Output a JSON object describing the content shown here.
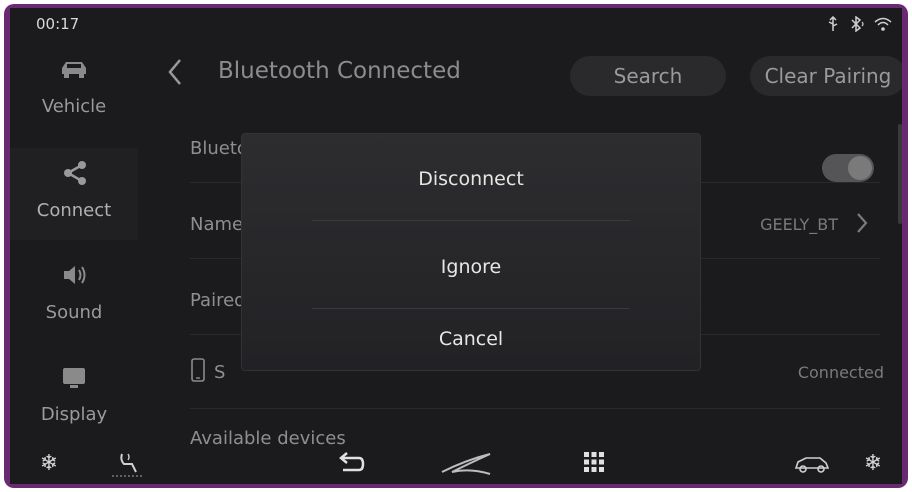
{
  "status": {
    "time": "00:17",
    "icons": [
      "usb-icon",
      "bluetooth-icon",
      "wifi-icon"
    ]
  },
  "sidebar": {
    "items": [
      {
        "label": "Vehicle",
        "icon": "car-icon"
      },
      {
        "label": "Connect",
        "icon": "share-icon",
        "active": true
      },
      {
        "label": "Sound",
        "icon": "speaker-icon"
      },
      {
        "label": "Display",
        "icon": "monitor-icon"
      }
    ]
  },
  "header": {
    "title": "Bluetooth Connected",
    "search_label": "Search",
    "clear_label": "Clear Pairing"
  },
  "rows": {
    "bluetooth_device": "Bluetooth Device",
    "name_label": "Name",
    "name_value": "GEELY_BT",
    "paired_label": "Paired",
    "device_label": "S",
    "device_status": "Connected",
    "available": "Available devices"
  },
  "dialog": {
    "disconnect": "Disconnect",
    "ignore": "Ignore",
    "cancel": "Cancel"
  },
  "bottombar": {
    "icons": [
      "snowflake-icon",
      "seat-heat-icon",
      "back-arrow-icon",
      "logo-icon",
      "apps-grid-icon",
      "car-outline-icon",
      "snowflake-icon"
    ]
  },
  "colors": {
    "frame": "#6a2a72",
    "screen_bg": "#1b1b1d",
    "dialog_bg": "#2a2a2d"
  }
}
